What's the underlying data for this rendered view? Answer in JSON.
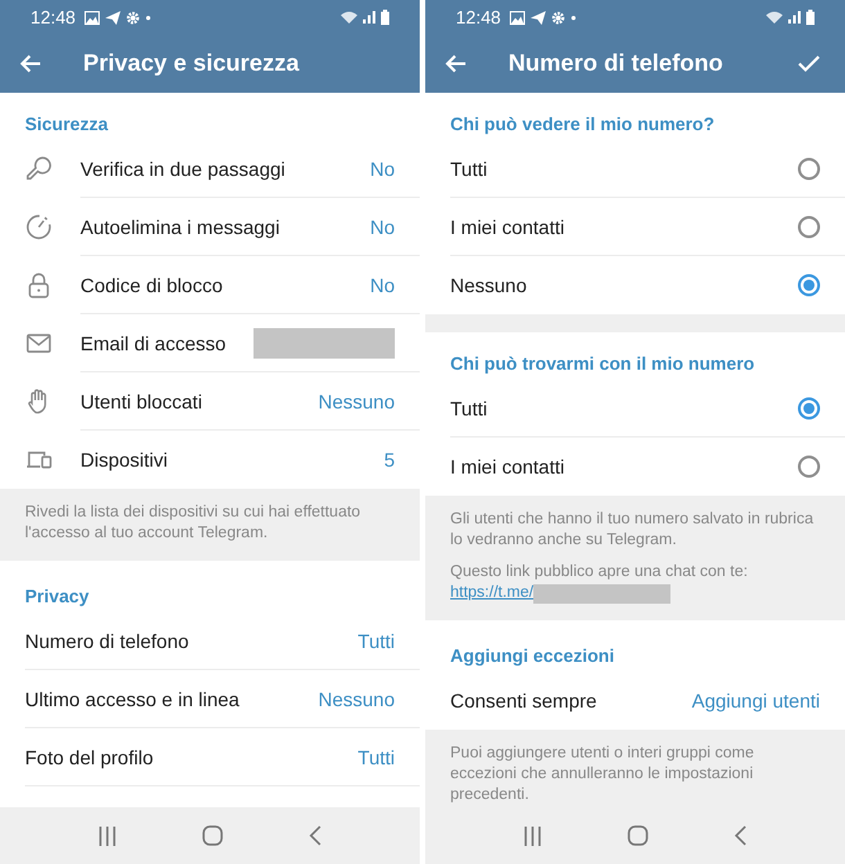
{
  "screens": [
    {
      "time": "12:48",
      "title": "Privacy e sicurezza",
      "blocks": [
        {
          "kind": "header",
          "text": "Sicurezza"
        },
        {
          "kind": "icon_setting",
          "label": "Verifica in due passaggi",
          "value": "No"
        },
        {
          "kind": "icon_setting",
          "label": "Autoelimina i messaggi",
          "value": "No"
        },
        {
          "kind": "icon_setting",
          "label": "Codice di blocco",
          "value": "No"
        },
        {
          "kind": "icon_setting",
          "label": "Email di accesso",
          "redacted": true
        },
        {
          "kind": "icon_setting",
          "label": "Utenti bloccati",
          "value": "Nessuno"
        },
        {
          "kind": "icon_setting",
          "label": "Dispositivi",
          "value": "5"
        },
        {
          "kind": "note",
          "paragraphs": [
            {
              "text": "Rivedi la lista dei dispositivi su cui hai effettuato l'accesso al tuo account Telegram."
            }
          ]
        },
        {
          "kind": "header",
          "text": "Privacy"
        },
        {
          "kind": "setting",
          "label": "Numero di telefono",
          "value": "Tutti"
        },
        {
          "kind": "setting",
          "label": "Ultimo accesso e in linea",
          "value": "Nessuno"
        },
        {
          "kind": "setting",
          "label": "Foto del profilo",
          "value": "Tutti"
        }
      ]
    },
    {
      "time": "12:48",
      "title": "Numero di telefono",
      "confirm": true,
      "blocks": [
        {
          "kind": "header",
          "text": "Chi può vedere il mio numero?"
        },
        {
          "kind": "radio",
          "label": "Tutti",
          "selected": false
        },
        {
          "kind": "radio",
          "label": "I miei contatti",
          "selected": false
        },
        {
          "kind": "radio",
          "label": "Nessuno",
          "selected": true
        },
        {
          "kind": "spacer"
        },
        {
          "kind": "header",
          "text": "Chi può trovarmi con il mio numero"
        },
        {
          "kind": "radio",
          "label": "Tutti",
          "selected": true
        },
        {
          "kind": "radio",
          "label": "I miei contatti",
          "selected": false
        },
        {
          "kind": "note",
          "paragraphs": [
            {
              "text": "Gli utenti che hanno il tuo numero salvato in rubrica lo vedranno anche su Telegram."
            },
            {
              "text": "Questo link pubblico apre una chat con te:",
              "link": "https://t.me/",
              "redacted": true
            }
          ]
        },
        {
          "kind": "header",
          "text": "Aggiungi eccezioni"
        },
        {
          "kind": "setting",
          "label": "Consenti sempre",
          "value": "Aggiungi utenti"
        },
        {
          "kind": "note",
          "paragraphs": [
            {
              "text": "Puoi aggiungere utenti o interi gruppi come eccezioni che annulleranno le impostazioni precedenti."
            }
          ]
        }
      ]
    }
  ]
}
